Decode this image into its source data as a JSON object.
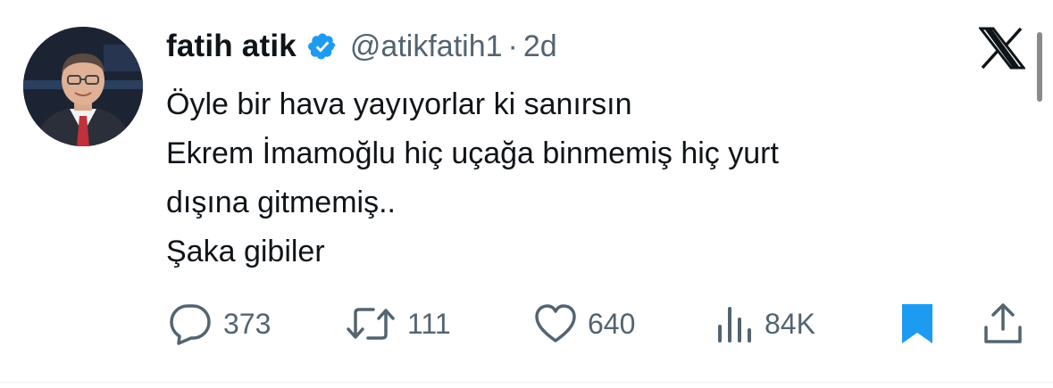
{
  "author": {
    "display_name": "fatih atik",
    "handle": "@atikfatih1",
    "separator": "·",
    "time_ago": "2d",
    "verified": true
  },
  "tweet": {
    "lines": [
      "Öyle bir hava yayıyorlar ki sanırsın",
      "Ekrem İmamoğlu hiç uçağa binmemiş hiç yurt",
      "dışına gitmemiş..",
      "Şaka gibiler"
    ]
  },
  "actions": {
    "replies": "373",
    "retweets": "111",
    "likes": "640",
    "views": "84K",
    "bookmarked": true
  },
  "icons": {
    "verified": "verified-badge-icon",
    "platform": "x-logo-icon",
    "reply": "reply-icon",
    "retweet": "retweet-icon",
    "like": "heart-icon",
    "views": "views-bar-chart-icon",
    "bookmark": "bookmark-icon",
    "share": "share-icon"
  },
  "colors": {
    "text": "#0f1419",
    "secondary": "#536471",
    "verified_blue": "#1d9bf0",
    "bookmark_blue": "#1d9bf0"
  }
}
